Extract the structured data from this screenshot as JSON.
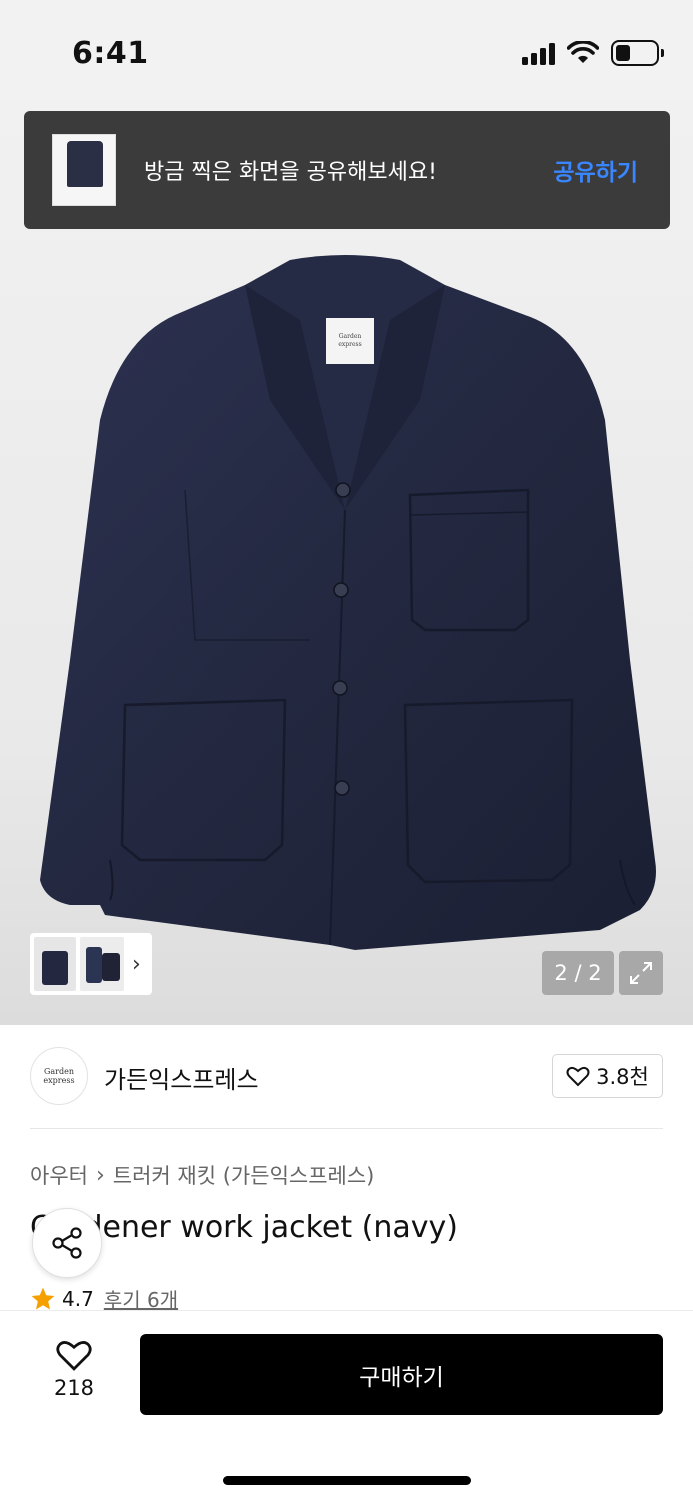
{
  "status_bar": {
    "time": "6:41"
  },
  "toast": {
    "message": "방금 찍은 화면을 공유해보세요!",
    "action": "공유하기"
  },
  "gallery": {
    "page_counter": "2 / 2",
    "brand_tag": "Garden express"
  },
  "brand": {
    "name": "가든익스프레스",
    "logo_text": "Garden express",
    "favorite_count": "3.8천"
  },
  "breadcrumb": {
    "category": "아우터",
    "subcategory": "트러커 재킷 (가든익스프레스)"
  },
  "product": {
    "title": "Gardener work jacket (navy)",
    "rating": "4.7",
    "reviews_label": "후기 6개"
  },
  "bottom_bar": {
    "like_count": "218",
    "buy_label": "구매하기"
  },
  "colors": {
    "toast_bg": "#3b3b3b",
    "toast_action": "#3a86ff",
    "jacket_navy": "#232840",
    "star": "#f5a000",
    "buy_button": "#000000"
  }
}
